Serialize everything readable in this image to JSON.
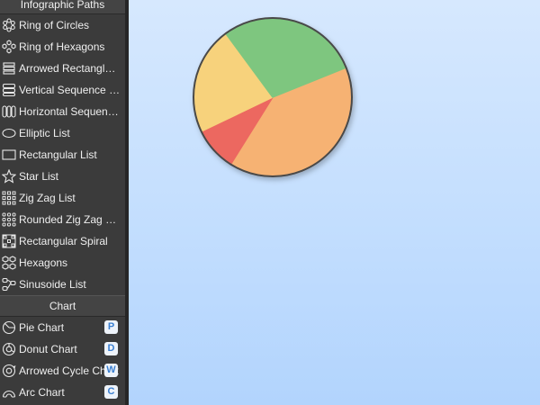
{
  "sidebar": {
    "sections": [
      {
        "title": "Infographic Paths",
        "items": [
          {
            "label": "Ring of Circles",
            "icon": "ring-of-circles-icon"
          },
          {
            "label": "Ring of Hexagons",
            "icon": "ring-of-hexagons-icon"
          },
          {
            "label": "Arrowed Rectangle L...",
            "icon": "arrowed-rectangle-list-icon"
          },
          {
            "label": "Vertical Sequence Li...",
            "icon": "vertical-sequence-list-icon"
          },
          {
            "label": "Horizontal Sequence...",
            "icon": "horizontal-sequence-icon"
          },
          {
            "label": "Elliptic List",
            "icon": "elliptic-list-icon"
          },
          {
            "label": "Rectangular List",
            "icon": "rectangular-list-icon"
          },
          {
            "label": "Star List",
            "icon": "star-list-icon"
          },
          {
            "label": "Zig Zag List",
            "icon": "zig-zag-list-icon"
          },
          {
            "label": "Rounded Zig Zag List",
            "icon": "rounded-zig-zag-list-icon"
          },
          {
            "label": "Rectangular Spiral",
            "icon": "rectangular-spiral-icon"
          },
          {
            "label": "Hexagons",
            "icon": "hexagons-icon"
          },
          {
            "label": "Sinusoide List",
            "icon": "sinusoide-list-icon"
          }
        ]
      },
      {
        "title": "Chart",
        "items": [
          {
            "label": "Pie Chart",
            "icon": "pie-chart-icon",
            "shortcut": "P"
          },
          {
            "label": "Donut Chart",
            "icon": "donut-chart-icon",
            "shortcut": "D"
          },
          {
            "label": "Arrowed Cycle Chart",
            "icon": "arrowed-cycle-chart-icon",
            "shortcut": "W"
          },
          {
            "label": "Arc Chart",
            "icon": "arc-chart-icon",
            "shortcut": "C"
          }
        ]
      }
    ]
  },
  "canvas": {
    "pie": {
      "slices": [
        {
          "value": 0.4,
          "color": "#f6b273"
        },
        {
          "value": 0.09,
          "color": "#ec6760"
        },
        {
          "value": 0.22,
          "color": "#f7d27c"
        },
        {
          "value": 0.29,
          "color": "#7ec67f"
        }
      ],
      "start_angle_deg": -22,
      "outline_color": "#4a4a4a"
    }
  }
}
